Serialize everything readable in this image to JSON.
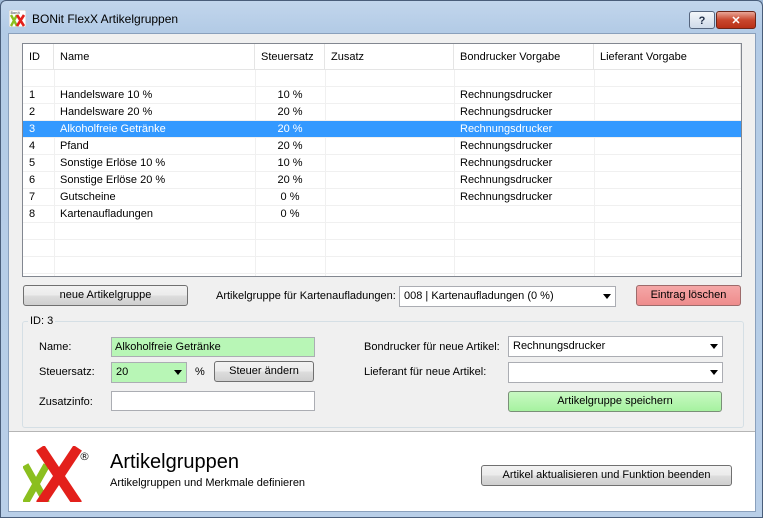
{
  "window": {
    "title": "BONit FlexX Artikelgruppen",
    "logo_mark": "Bonit",
    "help_label": "?",
    "close_label": "✕"
  },
  "table": {
    "columns": [
      "ID",
      "Name",
      "Steuersatz",
      "Zusatz",
      "Bondrucker Vorgabe",
      "Lieferant Vorgabe"
    ],
    "rows": [
      {
        "id": "1",
        "name": "Handelsware 10 %",
        "tax": "10 %",
        "extra": "",
        "printer": "Rechnungsdrucker",
        "supplier": ""
      },
      {
        "id": "2",
        "name": "Handelsware 20 %",
        "tax": "20 %",
        "extra": "",
        "printer": "Rechnungsdrucker",
        "supplier": ""
      },
      {
        "id": "3",
        "name": "Alkoholfreie Getränke",
        "tax": "20 %",
        "extra": "",
        "printer": "Rechnungsdrucker",
        "supplier": ""
      },
      {
        "id": "4",
        "name": "Pfand",
        "tax": "20 %",
        "extra": "",
        "printer": "Rechnungsdrucker",
        "supplier": ""
      },
      {
        "id": "5",
        "name": "Sonstige Erlöse 10 %",
        "tax": "10 %",
        "extra": "",
        "printer": "Rechnungsdrucker",
        "supplier": ""
      },
      {
        "id": "6",
        "name": "Sonstige Erlöse 20 %",
        "tax": "20 %",
        "extra": "",
        "printer": "Rechnungsdrucker",
        "supplier": ""
      },
      {
        "id": "7",
        "name": "Gutscheine",
        "tax": "0 %",
        "extra": "",
        "printer": "Rechnungsdrucker",
        "supplier": ""
      },
      {
        "id": "8",
        "name": "Kartenaufladungen",
        "tax": "0 %",
        "extra": "",
        "printer": "",
        "supplier": ""
      }
    ],
    "selected_row": 3
  },
  "toolbar": {
    "new_group_label": "neue Artikelgruppe",
    "card_group_label": "Artikelgruppe für Kartenaufladungen:",
    "card_group_value": "008 | Kartenaufladungen (0 %)",
    "delete_label": "Eintrag löschen"
  },
  "detail": {
    "id_label": "ID: 3",
    "name_label": "Name:",
    "name_value": "Alkoholfreie Getränke",
    "tax_label": "Steuersatz:",
    "tax_value": "20",
    "tax_unit": "%",
    "change_tax_label": "Steuer ändern",
    "extra_label": "Zusatzinfo:",
    "extra_value": "",
    "printer_label": "Bondrucker für neue Artikel:",
    "printer_value": "Rechnungsdrucker",
    "supplier_label": "Lieferant für neue Artikel:",
    "supplier_value": "",
    "save_label": "Artikelgruppe speichern"
  },
  "footer": {
    "title": "Artikelgruppen",
    "subtitle": "Artikelgruppen und Merkmale definieren",
    "finish_label": "Artikel aktualisieren und Funktion beenden",
    "registered_mark": "®"
  },
  "colors": {
    "selection": "#3399ff",
    "logo_red": "#e3201b",
    "logo_green": "#8bbf1f",
    "field_green": "#b8f6b6",
    "delete_red": "#ee8c8c"
  }
}
